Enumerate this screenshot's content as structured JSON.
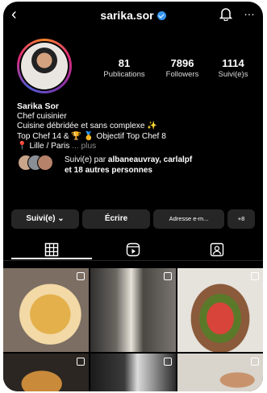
{
  "header": {
    "username": "sarika.sor",
    "back_icon": "chevron-left-icon",
    "notification_icon": "bell-icon",
    "more_icon": "more-icon"
  },
  "profile": {
    "stats": [
      {
        "value": "81",
        "label": "Publications"
      },
      {
        "value": "7896",
        "label": "Followers"
      },
      {
        "value": "1114",
        "label": "Suivi(e)s"
      }
    ],
    "name": "Sarika Sor",
    "category": "Chef cuisinier",
    "bio_lines": [
      "Cuisine débridée et sans complexe ✨",
      "Top Chef 14 & 🏆 🥇 Objectif Top Chef 8"
    ],
    "location": "📍 Lille / Paris",
    "more_label": "... plus",
    "mutual": {
      "prefix": "Suivi(e) par ",
      "names": "albaneauvray, carlalpf",
      "suffix": "et 18 autres personnes"
    }
  },
  "actions": {
    "follow_label": "Suivi(e) ⌄",
    "message_label": "Écrire",
    "email_label": "Adresse e-m...",
    "add_user_label": "+8"
  },
  "tabs": [
    {
      "icon": "grid-icon"
    },
    {
      "icon": "reels-icon"
    },
    {
      "icon": "tagged-icon"
    }
  ],
  "colors": {
    "background": "#000000",
    "button": "#262626",
    "verified": "#3897f0",
    "muted": "#8e8e8e"
  }
}
